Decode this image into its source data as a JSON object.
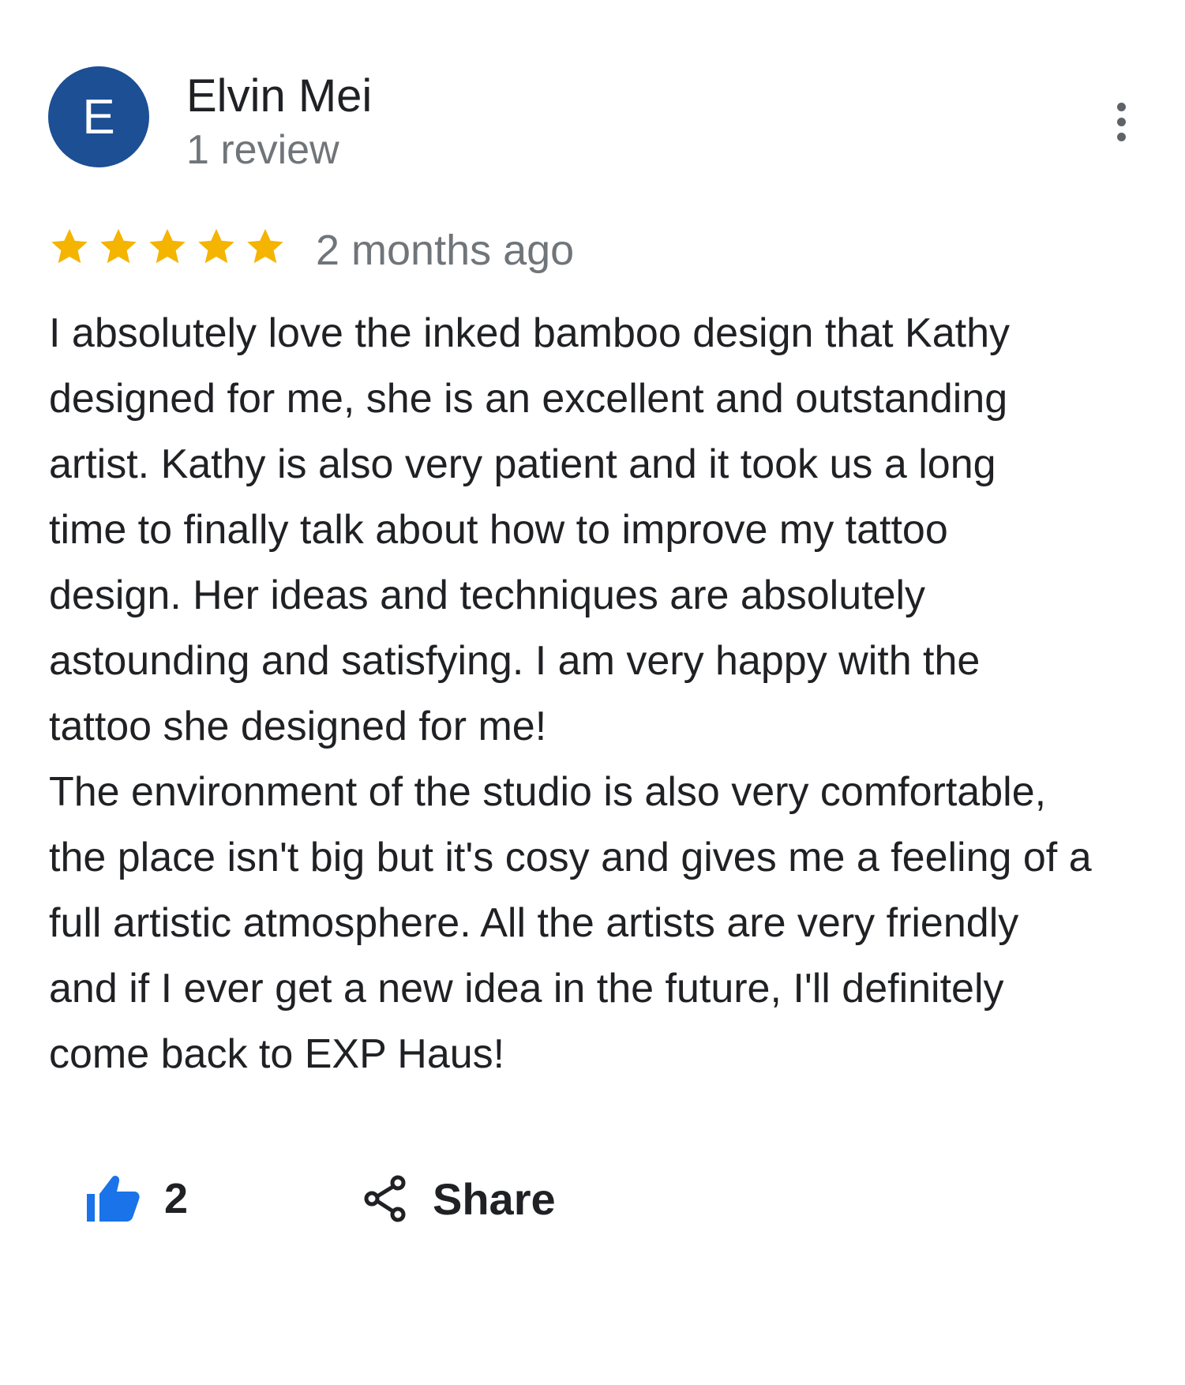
{
  "author": {
    "initial": "E",
    "name": "Elvin Mei",
    "review_count": "1 review"
  },
  "colors": {
    "avatar": "#1c4f94",
    "star": "#f4b400",
    "like": "#1a73e8",
    "secondary_text": "#70757a"
  },
  "icons": {
    "menu": "more-vert-icon",
    "star": "star-icon",
    "like": "thumbs-up-icon",
    "share": "share-icon"
  },
  "review": {
    "rating": 5,
    "max_rating": 5,
    "date": "2 months ago",
    "lines": [
      "I absolutely love the inked bamboo design that Kathy",
      "designed for me, she is an excellent and outstanding",
      "artist. Kathy is also very patient and it took us a long",
      "time to finally talk about how to improve my tattoo",
      "design. Her ideas and techniques are absolutely",
      "astounding and satisfying. I am very happy with the",
      "tattoo she designed for me!",
      "The environment of the studio is also very comfortable,",
      "the place isn't big but it's cosy and gives me a feeling of a",
      "full artistic atmosphere. All the artists are very friendly",
      "and if I ever get a new idea in the future, I'll definitely",
      "come back to EXP Haus!"
    ]
  },
  "actions": {
    "like_count": "2",
    "share_label": "Share"
  }
}
